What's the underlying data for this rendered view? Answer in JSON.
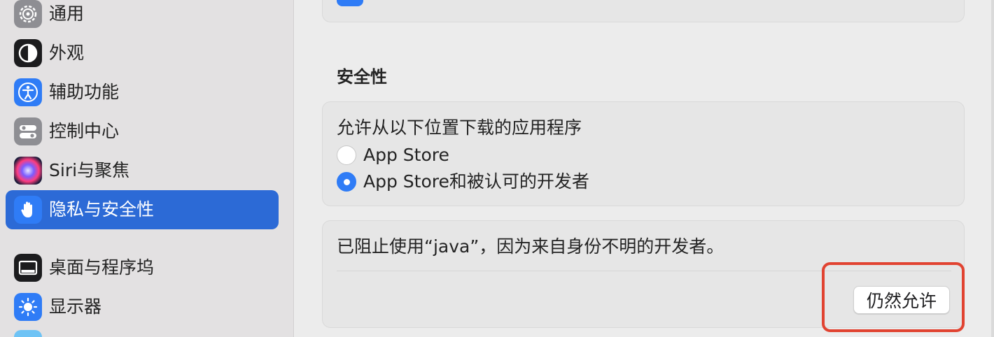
{
  "sidebar": {
    "items": [
      {
        "label": "通用",
        "icon": "gear-icon",
        "color": "#8e8e93"
      },
      {
        "label": "外观",
        "icon": "appearance-icon",
        "color": "#1c1c1e"
      },
      {
        "label": "辅助功能",
        "icon": "accessibility-icon",
        "color": "#2f7cf6"
      },
      {
        "label": "控制中心",
        "icon": "control-center-icon",
        "color": "#8e8e93"
      },
      {
        "label": "Siri与聚焦",
        "icon": "siri-icon",
        "color": "#3a2a5e"
      },
      {
        "label": "隐私与安全性",
        "icon": "hand-icon",
        "color": "#2f7cf6",
        "selected": true
      },
      {
        "label": "桌面与程序坞",
        "icon": "dock-icon",
        "color": "#1c1c1e"
      },
      {
        "label": "显示器",
        "icon": "display-brightness-icon",
        "color": "#2f7cf6"
      }
    ]
  },
  "security": {
    "section_title": "安全性",
    "allow_heading": "允许从以下位置下载的应用程序",
    "options": [
      {
        "label": "App Store",
        "selected": false
      },
      {
        "label": "App Store和被认可的开发者",
        "selected": true
      }
    ],
    "blocked_message": "已阻止使用“java”，因为来自身份不明的开发者。",
    "allow_anyway_label": "仍然允许"
  },
  "colors": {
    "accent": "#2f7cf6",
    "selected_sidebar": "#2c6ad6",
    "highlight_box": "#e14331"
  }
}
